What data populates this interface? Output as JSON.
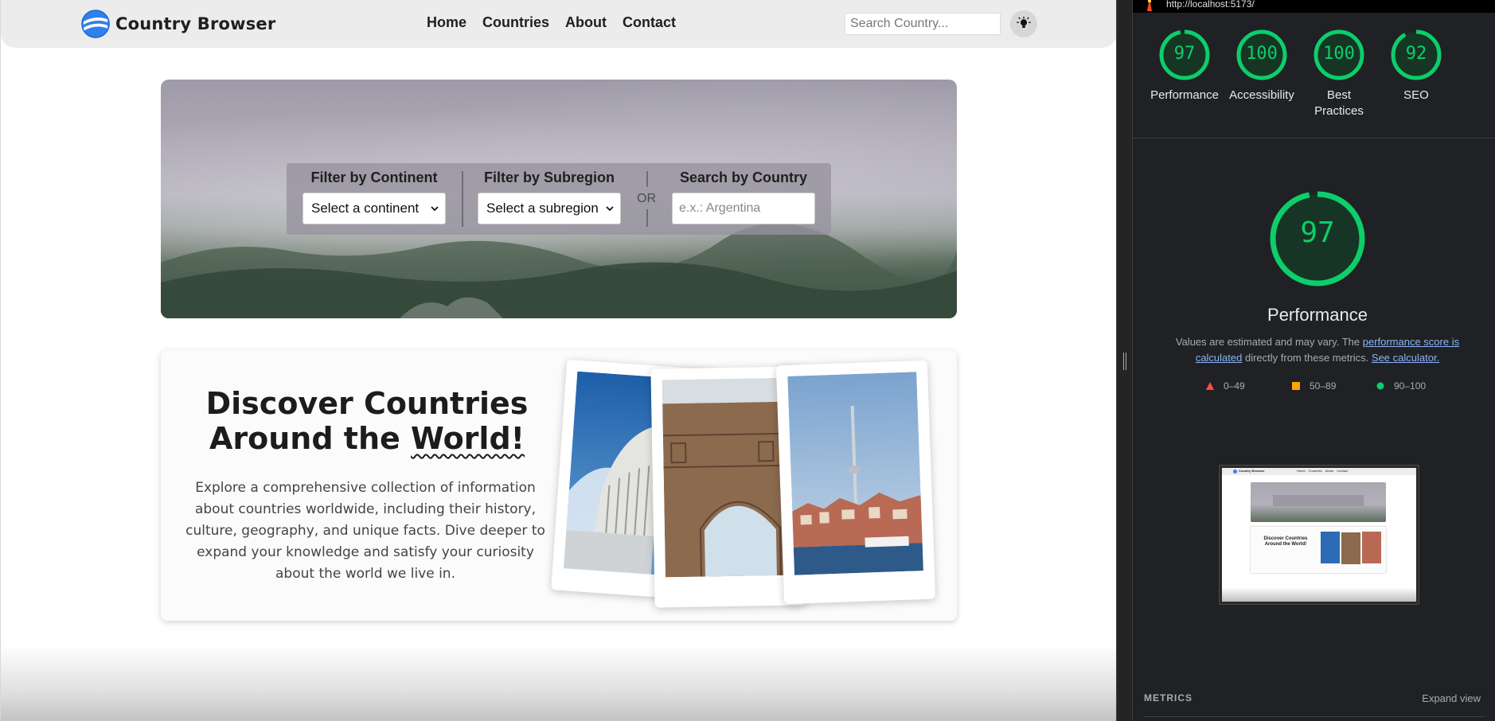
{
  "navbar": {
    "brand_name": "Country Browser",
    "links": [
      "Home",
      "Countries",
      "About",
      "Contact"
    ],
    "search_placeholder": "Search Country..."
  },
  "hero": {
    "continent_label": "Filter by Continent",
    "continent_value": "Select a continent",
    "subregion_label": "Filter by Subregion",
    "subregion_value": "Select a subregion",
    "or_text": "OR",
    "country_label": "Search by Country",
    "country_placeholder": "e.x.: Argentina"
  },
  "discover": {
    "title_line1": "Discover Countries",
    "title_line2_a": "Around the ",
    "title_line2_b": "World!",
    "text": "Explore a comprehensive collection of information about countries worldwide, including their history, culture, geography, and unique facts. Dive deeper to expand your knowledge and satisfy your curiosity about the world we live in."
  },
  "lighthouse": {
    "url": "http://localhost:5173/",
    "scores": [
      {
        "label": "Performance",
        "value": 97
      },
      {
        "label": "Accessibility",
        "value": 100
      },
      {
        "label": "Best Practices",
        "value": 100
      },
      {
        "label": "SEO",
        "value": 92
      }
    ],
    "main_score": 97,
    "main_title": "Performance",
    "desc_pre": "Values are estimated and may vary. The ",
    "desc_link1": "performance score is calculated",
    "desc_mid": " directly from these metrics. ",
    "desc_link2": "See calculator.",
    "legend": [
      {
        "range": "0–49",
        "color": "#ff4e42",
        "shape": "triangle"
      },
      {
        "range": "50–89",
        "color": "#ffa400",
        "shape": "square"
      },
      {
        "range": "90–100",
        "color": "#0cce6b",
        "shape": "circle"
      }
    ],
    "metrics_label": "METRICS",
    "expand_label": "Expand view",
    "thumbnail": {
      "brand": "Country Browser",
      "links": [
        "Home",
        "Countries",
        "About",
        "Contact"
      ],
      "title_line1": "Discover Countries",
      "title_line2": "Around the World!"
    }
  },
  "colors": {
    "score_good": "#0cce6b",
    "link": "#8ab4f8",
    "panel_bg": "#202124"
  }
}
